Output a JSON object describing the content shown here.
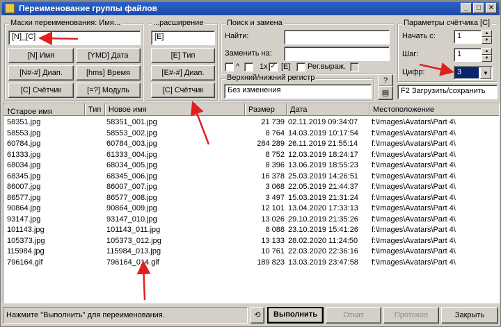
{
  "window": {
    "title": "Переименование группы файлов"
  },
  "masks": {
    "group_title": "Маски переименования: Имя...",
    "name_value": "[N]_[C]",
    "btn_name": "[N]  Имя",
    "btn_ymd": "[YMD]  Дата",
    "btn_range": "[N#-#]  Диап.",
    "btn_hms": "[hms]  Время",
    "btn_counter": "[C]  Счётчик",
    "btn_module": "[=?]  Модуль"
  },
  "extension": {
    "group_title": "...расширение",
    "value": "[E]",
    "btn_type": "[E]  Тип",
    "btn_range": "[E#-#]  Диап.",
    "btn_counter": "[C]  Счётчик"
  },
  "search": {
    "group_title": "Поиск и замена",
    "find_label": "Найти:",
    "replace_label": "Заменить на:",
    "find_value": "",
    "replace_value": "",
    "opt_caret": "^",
    "opt_1x": "1x",
    "opt_e": "[E]",
    "opt_regex": "Рег.выраж.",
    "check_mark": "✓"
  },
  "case": {
    "group_title": "Верхний/нижний регистр",
    "value": "Без изменения",
    "help_label": "?"
  },
  "counter": {
    "group_title": "Параметры счётчика [C]",
    "start_label": "Начать с:",
    "start_value": "1",
    "step_label": "Шаг:",
    "step_value": "1",
    "digits_label": "Цифр:",
    "digits_value": "3",
    "load_save": "F2 Загрузить/сохранить"
  },
  "columns": [
    "Старое имя",
    "Тип",
    "Новое имя",
    "Размер",
    "Дата",
    "Местоположение"
  ],
  "files": [
    {
      "old": "58351.jpg",
      "new": "58351_001.jpg",
      "size": "21 739",
      "date": "02.11.2019 09:34:07",
      "loc": "f:\\Images\\Avatars\\Part 4\\"
    },
    {
      "old": "58553.jpg",
      "new": "58553_002.jpg",
      "size": "8 764",
      "date": "14.03.2019 10:17:54",
      "loc": "f:\\Images\\Avatars\\Part 4\\"
    },
    {
      "old": "60784.jpg",
      "new": "60784_003.jpg",
      "size": "284 289",
      "date": "26.11.2019 21:55:14",
      "loc": "f:\\Images\\Avatars\\Part 4\\"
    },
    {
      "old": "61333.jpg",
      "new": "61333_004.jpg",
      "size": "8 752",
      "date": "12.03.2019 18:24:17",
      "loc": "f:\\Images\\Avatars\\Part 4\\"
    },
    {
      "old": "68034.jpg",
      "new": "68034_005.jpg",
      "size": "8 396",
      "date": "13.06.2019 18:55:23",
      "loc": "f:\\Images\\Avatars\\Part 4\\"
    },
    {
      "old": "68345.jpg",
      "new": "68345_006.jpg",
      "size": "16 378",
      "date": "25.03.2019 14:26:51",
      "loc": "f:\\Images\\Avatars\\Part 4\\"
    },
    {
      "old": "86007.jpg",
      "new": "86007_007.jpg",
      "size": "3 068",
      "date": "22.05.2019 21:44:37",
      "loc": "f:\\Images\\Avatars\\Part 4\\"
    },
    {
      "old": "86577.jpg",
      "new": "86577_008.jpg",
      "size": "3 497",
      "date": "15.03.2019 21:31:24",
      "loc": "f:\\Images\\Avatars\\Part 4\\"
    },
    {
      "old": "90864.jpg",
      "new": "90864_009.jpg",
      "size": "12 101",
      "date": "13.04.2020 17:33:13",
      "loc": "f:\\Images\\Avatars\\Part 4\\"
    },
    {
      "old": "93147.jpg",
      "new": "93147_010.jpg",
      "size": "13 026",
      "date": "29.10.2019 21:35:26",
      "loc": "f:\\Images\\Avatars\\Part 4\\"
    },
    {
      "old": "101143.jpg",
      "new": "101143_011.jpg",
      "size": "8 088",
      "date": "23.10.2019 15:41:26",
      "loc": "f:\\Images\\Avatars\\Part 4\\"
    },
    {
      "old": "105373.jpg",
      "new": "105373_012.jpg",
      "size": "13 133",
      "date": "28.02.2020 11:24:50",
      "loc": "f:\\Images\\Avatars\\Part 4\\"
    },
    {
      "old": "115984.jpg",
      "new": "115984_013.jpg",
      "size": "10 761",
      "date": "22.03.2020 22:36:16",
      "loc": "f:\\Images\\Avatars\\Part 4\\"
    },
    {
      "old": "796164.gif",
      "new": "796164_014.gif",
      "size": "189 823",
      "date": "13.03.2019 23:47:58",
      "loc": "f:\\Images\\Avatars\\Part 4\\"
    }
  ],
  "status": {
    "text": "Нажмите \"Выполнить\" для переименования."
  },
  "actions": {
    "run": "Выполнить",
    "undo": "Откат",
    "log": "Протокол",
    "close": "Закрыть"
  },
  "colors": {
    "annotation_arrow": "#e02020",
    "title_bar": "#1c4aa8",
    "highlight": "#0a246a"
  }
}
